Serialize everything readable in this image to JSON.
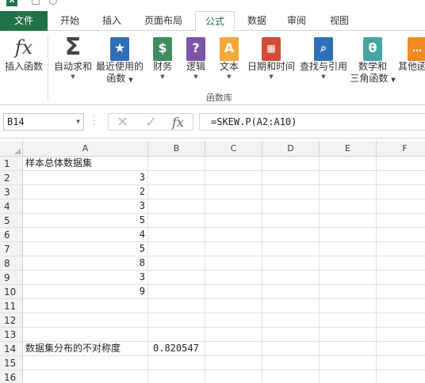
{
  "tabs": [
    "文件",
    "开始",
    "插入",
    "页面布局",
    "公式",
    "数据",
    "审阅",
    "视图"
  ],
  "ribbon": {
    "insert_function": "插入函数",
    "autosum": "自动求和",
    "recent_line1": "最近使用的",
    "recent_line2": "函数",
    "financial": "财务",
    "logical": "逻辑",
    "text": "文本",
    "datetime": "日期和时间",
    "lookup": "查找与引用",
    "math_line1": "数学和",
    "math_line2": "三角函数",
    "more": "其他函",
    "group_label": "函数库"
  },
  "formula_bar": {
    "name_box": "B14",
    "formula": "=SKEW.P(A2:A10)",
    "fx_symbol": "fx"
  },
  "columns": [
    "A",
    "B",
    "C",
    "D",
    "E",
    "F"
  ],
  "rows": [
    {
      "n": "1",
      "a": "样本总体数据集",
      "b": ""
    },
    {
      "n": "2",
      "a": "3",
      "b": ""
    },
    {
      "n": "3",
      "a": "2",
      "b": ""
    },
    {
      "n": "4",
      "a": "3",
      "b": ""
    },
    {
      "n": "5",
      "a": "5",
      "b": ""
    },
    {
      "n": "6",
      "a": "4",
      "b": ""
    },
    {
      "n": "7",
      "a": "5",
      "b": ""
    },
    {
      "n": "8",
      "a": "8",
      "b": ""
    },
    {
      "n": "9",
      "a": "3",
      "b": ""
    },
    {
      "n": "10",
      "a": "9",
      "b": ""
    },
    {
      "n": "11",
      "a": "",
      "b": ""
    },
    {
      "n": "12",
      "a": "",
      "b": ""
    },
    {
      "n": "13",
      "a": "",
      "b": ""
    },
    {
      "n": "14",
      "a": "数据集分布的不对称度",
      "b": "0.820547"
    },
    {
      "n": "15",
      "a": "",
      "b": ""
    },
    {
      "n": "16",
      "a": "",
      "b": ""
    }
  ],
  "colors": {
    "accent": "#217346"
  }
}
